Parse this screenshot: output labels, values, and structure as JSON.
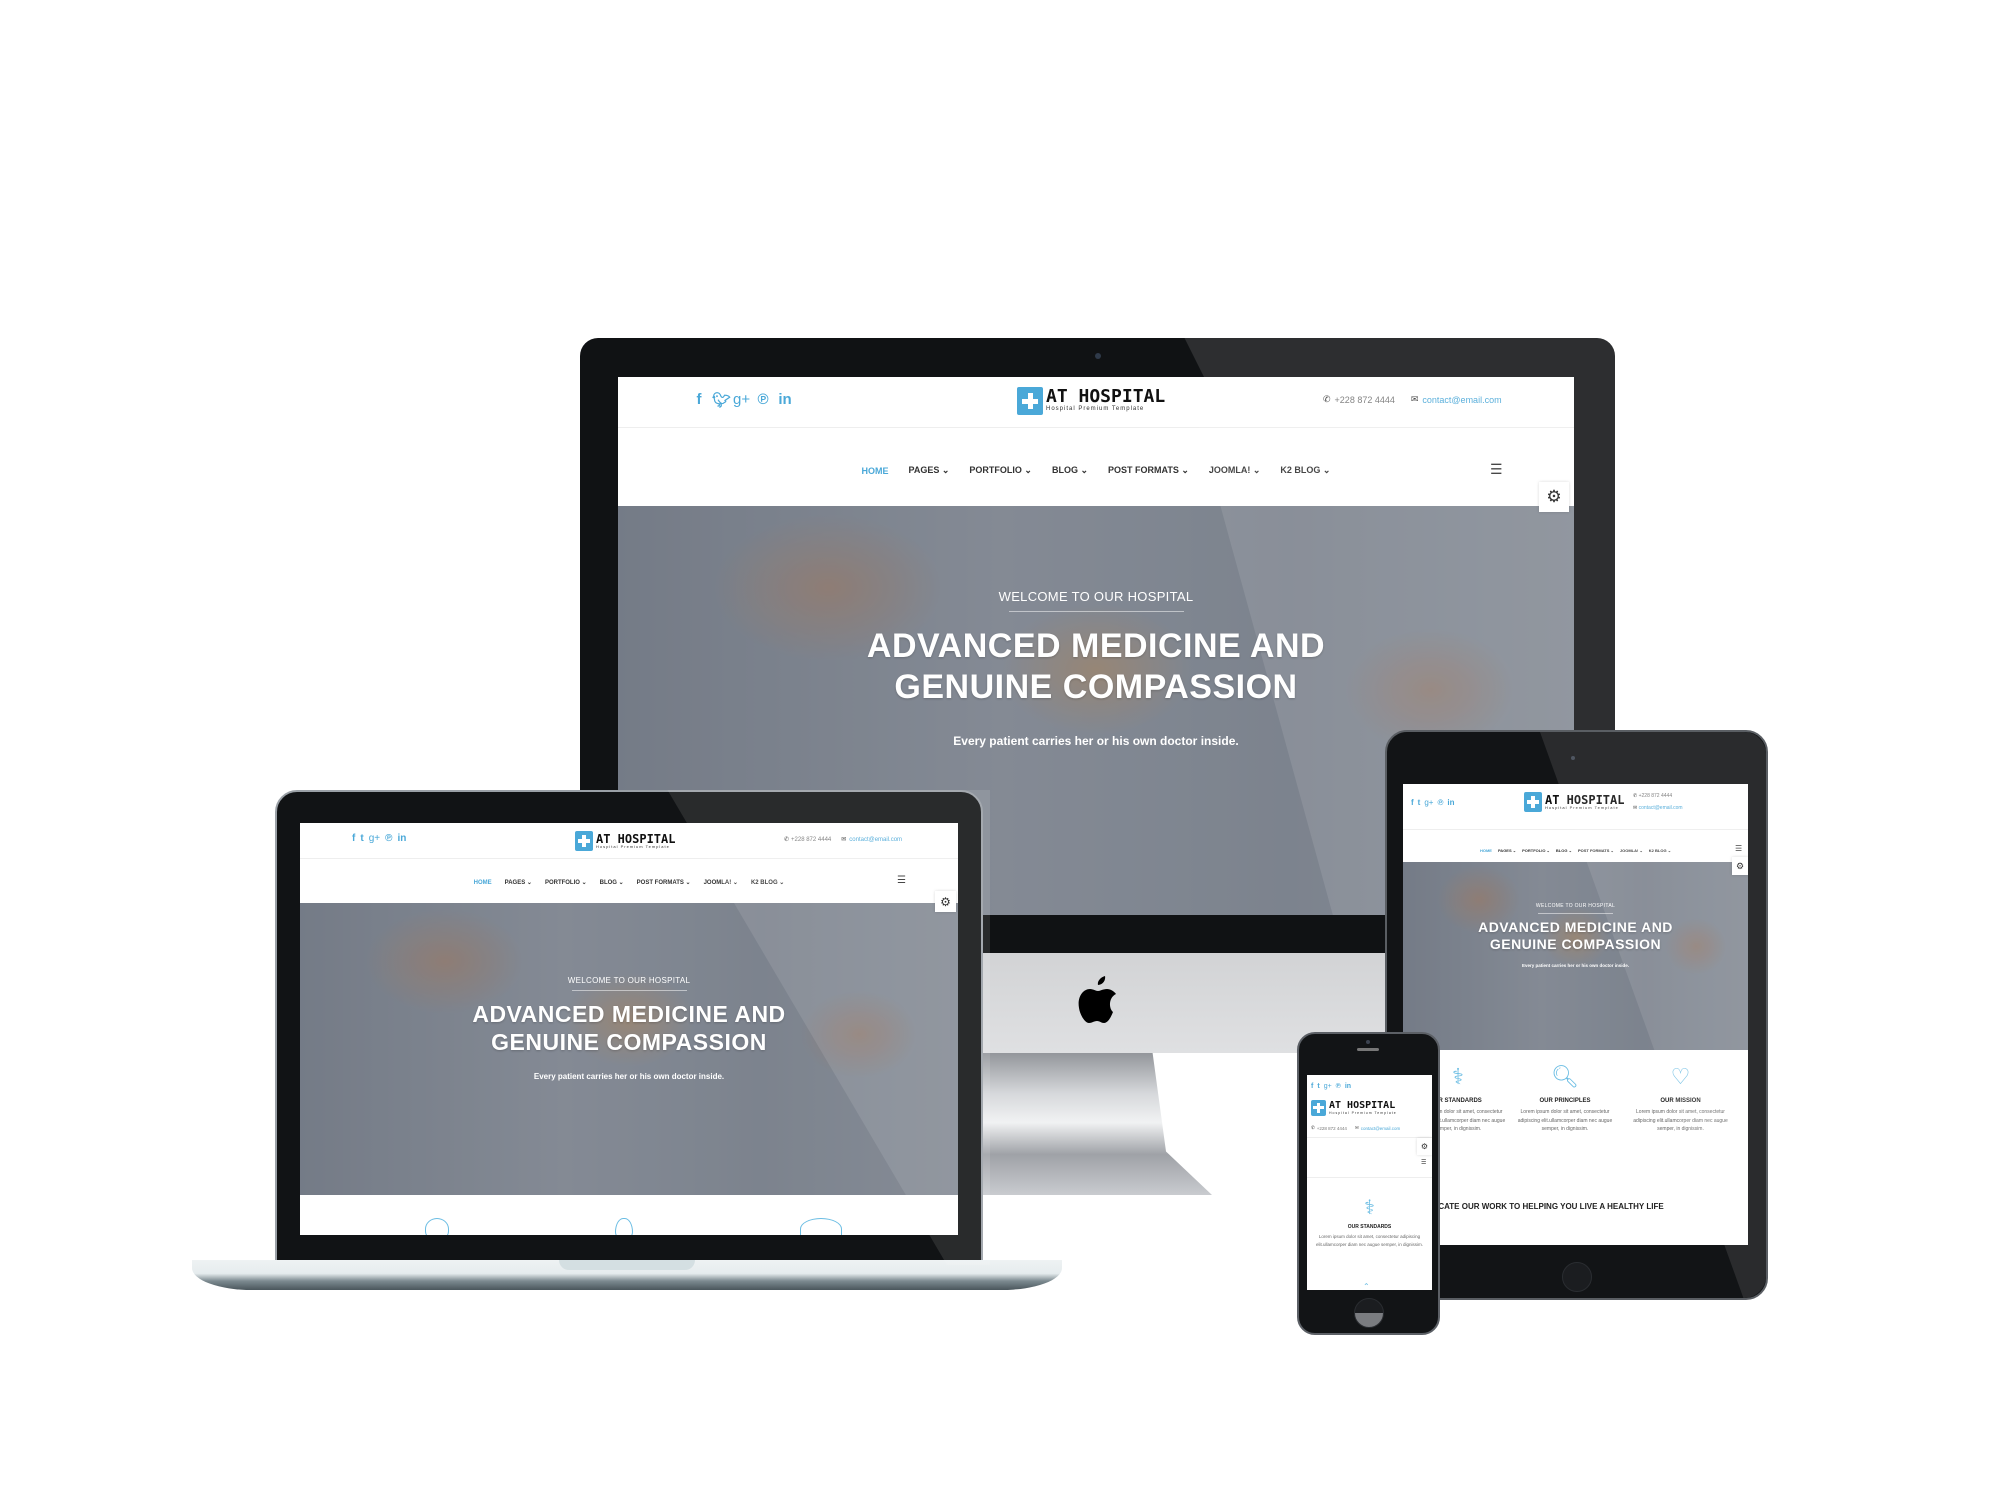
{
  "site": {
    "brand": {
      "title": "AT HOSPITAL",
      "subtitle": "Hospital Premium Template",
      "accent_color": "#4aa8d8"
    },
    "social_icons": [
      {
        "name": "facebook-icon",
        "glyph": "f"
      },
      {
        "name": "twitter-icon",
        "glyph": "t"
      },
      {
        "name": "google-plus-icon",
        "glyph": "g+"
      },
      {
        "name": "pinterest-icon",
        "glyph": "p"
      },
      {
        "name": "linkedin-icon",
        "glyph": "in"
      }
    ],
    "contact": {
      "phone": "+228 872 4444",
      "email": "contact@email.com"
    },
    "nav": [
      {
        "label": "HOME",
        "active": true
      },
      {
        "label": "PAGES",
        "dropdown": true
      },
      {
        "label": "PORTFOLIO",
        "dropdown": true
      },
      {
        "label": "BLOG",
        "dropdown": true
      },
      {
        "label": "POST FORMATS",
        "dropdown": true
      },
      {
        "label": "JOOMLA!",
        "dropdown": true
      },
      {
        "label": "K2 BLOG",
        "dropdown": true
      }
    ],
    "nav_labels": {
      "home": "HOME",
      "pages": "PAGES ⌄",
      "portfolio": "PORTFOLIO ⌄",
      "blog": "BLOG ⌄",
      "post_formats": "POST FORMATS ⌄",
      "joomla": "JOOMLA! ⌄",
      "k2_blog": "K2 BLOG ⌄"
    },
    "menu_icon": "☰",
    "settings_icon": "⚙",
    "hero": {
      "kicker": "WELCOME TO OUR HOSPITAL",
      "title_line1": "ADVANCED MEDICINE AND",
      "title_line2": "GENUINE COMPASSION",
      "subtitle": "Every patient carries her or his own doctor inside."
    },
    "features": [
      {
        "title": "OUR STANDARDS",
        "text": "Lorem ipsum dolor sit amet, consectetur adipiscing elit.ullamcorper diam nec augue semper, in dignissim."
      },
      {
        "title": "OUR PRINCIPLES",
        "text": "Lorem ipsum dolor sit amet, consectetur adipiscing elit.ullamcorper diam nec augue semper, in dignissim."
      },
      {
        "title": "OUR MISSION",
        "text": "Lorem ipsum dolor sit amet, consectetur adipiscing elit.ullamcorper diam nec augue semper, in dignissim."
      }
    ],
    "tablet_feature_partial_title": "UR STANDARDS",
    "tagline": "WE DEDICATE OUR WORK TO HELPING YOU LIVE A HEALTHY LIFE",
    "tagline_visible": "EDICATE OUR WORK TO HELPING YOU LIVE A HEALTHY LIFE"
  },
  "devices": {
    "apple_logo": ""
  }
}
